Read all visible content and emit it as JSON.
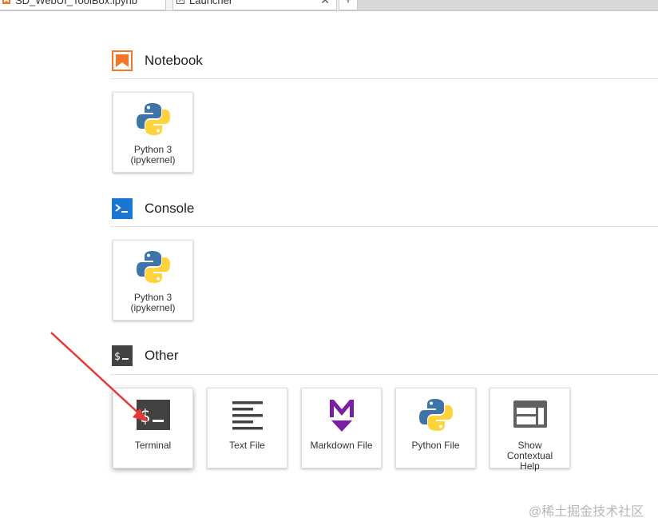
{
  "tabs": [
    {
      "label": "SD_WebUI_ToolBox.ipynb",
      "icon": "notebook-icon",
      "active": false
    },
    {
      "label": "Launcher",
      "icon": "launcher-icon",
      "active": true,
      "close": "✕"
    }
  ],
  "tab_add_label": "+",
  "sections": {
    "notebook": {
      "title": "Notebook",
      "icon": "notebook-section-icon",
      "accent": "#f37726"
    },
    "console": {
      "title": "Console",
      "icon": "console-section-icon",
      "accent": "#1976d2"
    },
    "other": {
      "title": "Other",
      "icon": "terminal-section-icon",
      "accent": "#424242"
    }
  },
  "cards": {
    "notebook_python": {
      "line1": "Python 3",
      "line2": "(ipykernel)",
      "icon": "python-icon"
    },
    "console_python": {
      "line1": "Python 3",
      "line2": "(ipykernel)",
      "icon": "python-icon"
    },
    "terminal": {
      "label": "Terminal",
      "icon": "terminal-icon"
    },
    "text_file": {
      "label": "Text File",
      "icon": "text-file-icon"
    },
    "markdown_file": {
      "label": "Markdown File",
      "icon": "markdown-icon",
      "color": "#7b1fa2"
    },
    "python_file": {
      "label": "Python File",
      "icon": "python-icon"
    },
    "contextual_help": {
      "line1": "Show",
      "line2": "Contextual",
      "line3": "Help",
      "icon": "contextual-help-icon"
    }
  },
  "colors": {
    "python_blue": "#3f74a8",
    "python_yellow": "#ffd43b",
    "arrow_red": "#e53935"
  },
  "watermark": "@稀土掘金技术社区"
}
